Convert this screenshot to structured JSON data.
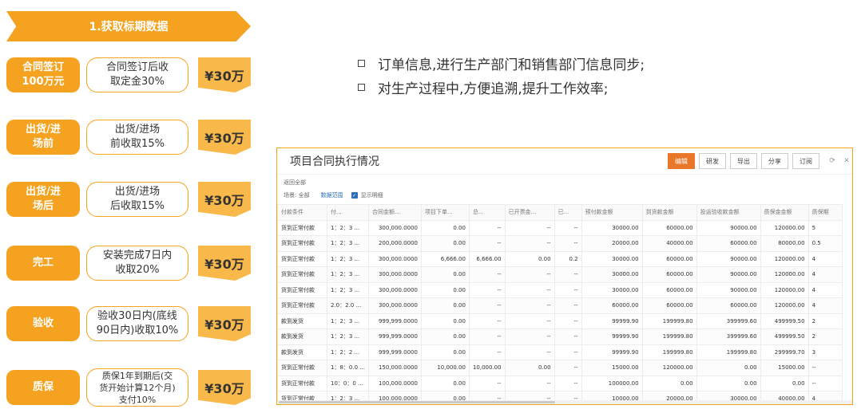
{
  "banner": "1.获取标期数据",
  "stages": [
    {
      "label": "合同签订\n100万元",
      "desc": "合同签订后收\n取定金30%",
      "amount": "¥30万"
    },
    {
      "label": "出货/进\n场前",
      "desc": "出货/进场\n前收取15%",
      "amount": "¥30万"
    },
    {
      "label": "出货/进\n场后",
      "desc": "出货/进场\n后收取15%",
      "amount": "¥30万"
    },
    {
      "label": "完工",
      "desc": "安装完成7日内\n收取20%",
      "amount": "¥30万"
    },
    {
      "label": "验收",
      "desc": "验收30日内(底线\n90日内)收取10%",
      "amount": "¥30万"
    },
    {
      "label": "质保",
      "desc": "质保1年到期后(交\n货开始计算12个月)\n支付10%",
      "amount": "¥30万"
    }
  ],
  "bullets": [
    "订单信息,进行生产部门和销售部门信息同步;",
    "对生产过程中,方便追溯,提升工作效率;"
  ],
  "panel": {
    "title": "项目合同执行情况",
    "buttons": [
      "编辑",
      "研发",
      "导出",
      "分享",
      "订阅"
    ],
    "breadcrumb": "返回全部",
    "filter_label": "场景: 全部",
    "data_range": "数据范围",
    "show_detail": "显示明细",
    "columns": [
      "付款条件",
      "付...",
      "合同金额...",
      "项目下单...",
      "总...",
      "已开票金...",
      "已...",
      "预付款金额",
      "到货款金额",
      "投运验收款金额",
      "质保金金额",
      "质保期"
    ],
    "rows": [
      [
        "货到正常付款",
        "1：2：3 ...",
        "300,000.0000",
        "0.00",
        "--",
        "--",
        "--",
        "30000.00",
        "60000.00",
        "90000.00",
        "120000.00",
        "5"
      ],
      [
        "货到正常付款",
        "1：2：3 ...",
        "200,000.0000",
        "0.00",
        "--",
        "--",
        "--",
        "20000.00",
        "40000.00",
        "60000.00",
        "80000.00",
        "0.5"
      ],
      [
        "货到正常付款",
        "1：2：3 ...",
        "300,000.0000",
        "6,666.00",
        "6,666.00",
        "0.00",
        "0.2",
        "30000.00",
        "60000.00",
        "90000.00",
        "120000.00",
        "4"
      ],
      [
        "货到正常付款",
        "1：2：3 ...",
        "300,000.0000",
        "0.00",
        "--",
        "--",
        "--",
        "30000.00",
        "60000.00",
        "90000.00",
        "120000.00",
        "4"
      ],
      [
        "货到正常付款",
        "1：2：3 ...",
        "300,000.0000",
        "0.00",
        "--",
        "--",
        "--",
        "30000.00",
        "60000.00",
        "90000.00",
        "120000.00",
        "4"
      ],
      [
        "货到正常付款",
        "2.0：2.0 ...",
        "300,000.0000",
        "0.00",
        "--",
        "--",
        "--",
        "60000.00",
        "60000.00",
        "60000.00",
        "120000.00",
        "4"
      ],
      [
        "款到发货",
        "1：2：3 ...",
        "999,999.0000",
        "0.00",
        "--",
        "--",
        "--",
        "99999.90",
        "199999.80",
        "399999.60",
        "499999.50",
        "2"
      ],
      [
        "款到发货",
        "1：2：3 ...",
        "999,999.0000",
        "0.00",
        "--",
        "--",
        "--",
        "99999.90",
        "199999.80",
        "399999.60",
        "499999.50",
        "2"
      ],
      [
        "款到发货",
        "1：2：2 ...",
        "999,999.0000",
        "0.00",
        "--",
        "--",
        "--",
        "99999.90",
        "199999.80",
        "199999.80",
        "299999.70",
        "3"
      ],
      [
        "货到正常付款",
        "1：8：0.0 ...",
        "150,000.0000",
        "10,000.00",
        "10,000.00",
        "0.00",
        "--",
        "15000.00",
        "120000.00",
        "0.00",
        "15000.00",
        "--"
      ],
      [
        "货到正常付款",
        "10：0：0 ...",
        "100,000.0000",
        "0.00",
        "--",
        "--",
        "--",
        "100000.00",
        "0.00",
        "0.00",
        "0.00",
        "--"
      ],
      [
        "货到正常付款",
        "1：2：3 ...",
        "100,000.0000",
        "0.00",
        "--",
        "--",
        "--",
        "10000.00",
        "20000.00",
        "30000.00",
        "40000.00",
        "4"
      ]
    ]
  }
}
